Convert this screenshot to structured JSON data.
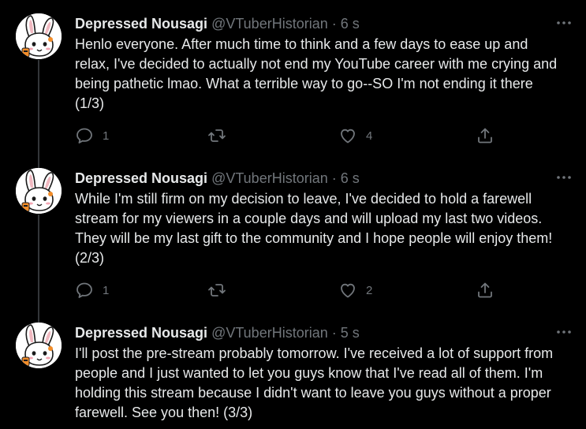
{
  "colors": {
    "background": "#000000",
    "text_primary": "#e7e9ea",
    "text_secondary": "#71767b",
    "thread_line": "#333639"
  },
  "icons": {
    "reply": "reply-icon",
    "retweet": "retweet-icon",
    "like": "heart-icon",
    "share": "share-icon",
    "more": "more-options-icon"
  },
  "tweets": [
    {
      "name": "Depressed Nousagi",
      "handle": "@VTuberHistorian",
      "separator": "·",
      "time": "6 s",
      "text": "Henlo everyone. After much time to think and a few days to ease up and relax, I've decided to actually not end my YouTube career with me crying and being pathetic lmao. What a terrible way to go--SO I'm not ending it there (1/3)",
      "replies": "1",
      "likes": "4"
    },
    {
      "name": "Depressed Nousagi",
      "handle": "@VTuberHistorian",
      "separator": "·",
      "time": "6 s",
      "text": "While I'm still firm on my decision to leave, I've decided to hold a farewell stream for my viewers in a couple days and will upload my last two videos. They will be my last gift to the community and I hope people will enjoy them! (2/3)",
      "replies": "1",
      "likes": "2"
    },
    {
      "name": "Depressed Nousagi",
      "handle": "@VTuberHistorian",
      "separator": "·",
      "time": "5 s",
      "text": "I'll post the pre-stream probably tomorrow. I've received a lot of support from people and I just wanted to let you guys know that I've read all of them. I'm holding this stream because I didn't want to leave you guys without a proper farewell. See you then! (3/3)"
    }
  ]
}
